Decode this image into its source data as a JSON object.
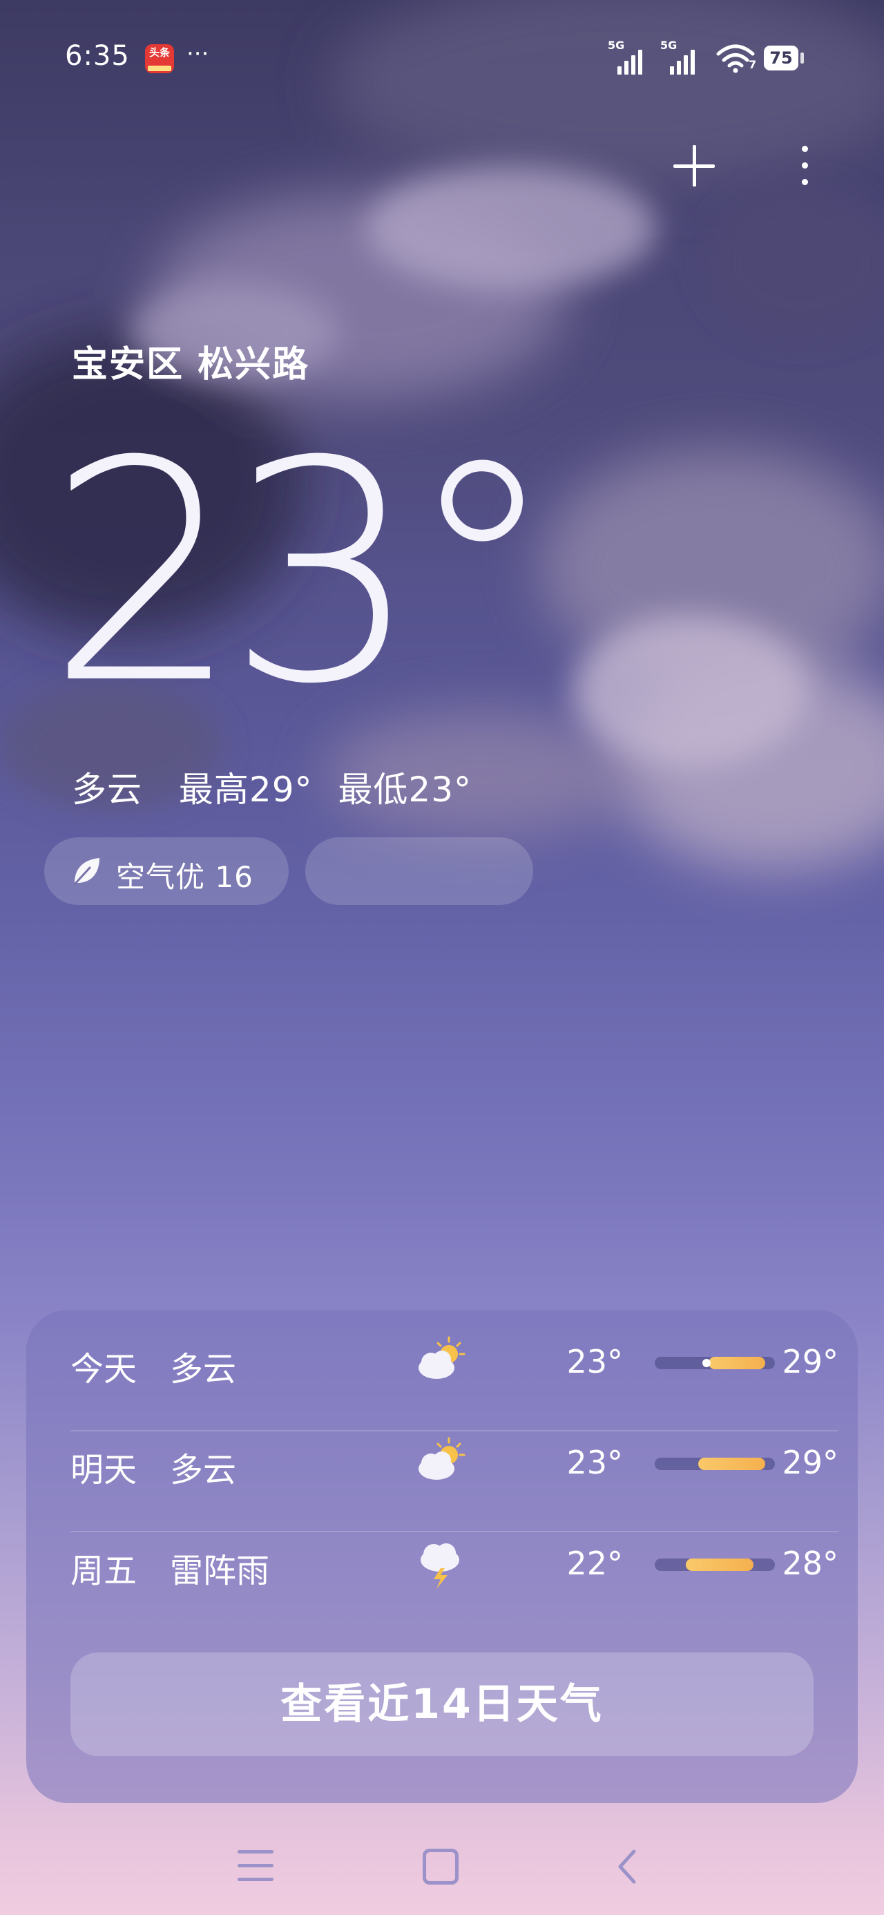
{
  "status_bar": {
    "time": "6:35",
    "app_badge_text": "头条",
    "more": "···",
    "sim1_label": "5G",
    "sim2_label": "5G",
    "wifi_label": "7",
    "battery": "75"
  },
  "toolbar": {
    "add_city_icon": "plus-icon",
    "more_icon": "more-vertical-icon"
  },
  "location": "宝安区 松兴路",
  "current": {
    "temperature": "23°",
    "condition": "多云",
    "high": "最高29°",
    "low": "最低23°"
  },
  "air_quality": {
    "icon": "leaf-icon",
    "label": "空气优 16"
  },
  "forecast": [
    {
      "day": "今天",
      "condition": "多云",
      "icon": "partly-cloudy-icon",
      "low": "23°",
      "high": "29°",
      "bar_start": 0.45,
      "bar_end": 0.92,
      "current_marker": 0.43
    },
    {
      "day": "明天",
      "condition": "多云",
      "icon": "partly-cloudy-icon",
      "low": "23°",
      "high": "29°",
      "bar_start": 0.36,
      "bar_end": 0.92,
      "current_marker": null
    },
    {
      "day": "周五",
      "condition": "雷阵雨",
      "icon": "thunderstorm-icon",
      "low": "22°",
      "high": "28°",
      "bar_start": 0.26,
      "bar_end": 0.82,
      "current_marker": null
    }
  ],
  "view_14_days": "查看近14日天气",
  "nav": {
    "menu_icon": "menu-icon",
    "home_icon": "home-icon",
    "back_icon": "back-icon"
  },
  "colors": {
    "accent_bar": "#f5b04f",
    "card_bg": "#7873b9"
  }
}
